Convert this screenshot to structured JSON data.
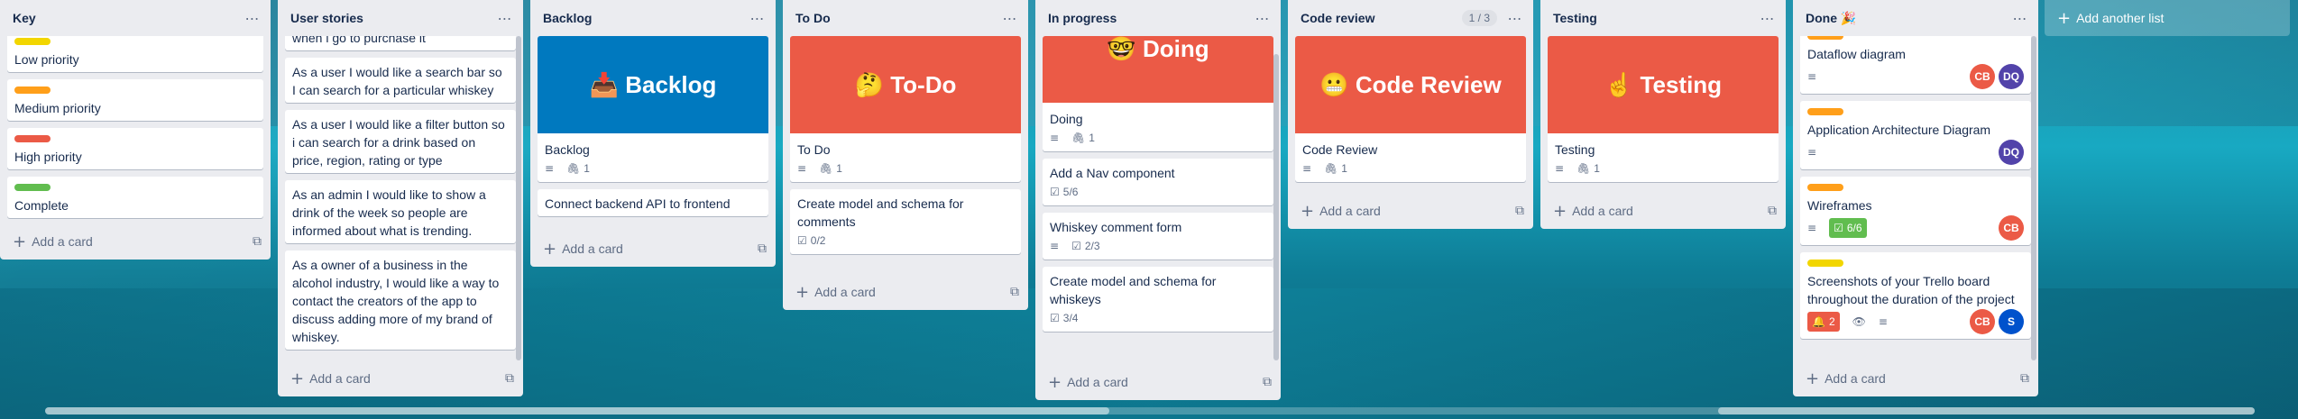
{
  "colors": {
    "yellow": "#f2d600",
    "orange": "#ff9f1a",
    "red": "#eb5a46",
    "green": "#61bd4f",
    "blue_cover": "#0079bf",
    "red_cover": "#eb5a46",
    "avatar_cb": "#eb5a46",
    "avatar_dq": "#5243aa",
    "avatar_s": "#0052cc"
  },
  "lists": {
    "key": {
      "title": "Key",
      "add_card": "Add a card",
      "cards": [
        {
          "text": "Low priority"
        },
        {
          "text": "Medium priority"
        },
        {
          "text": "High priority"
        },
        {
          "text": "Complete"
        }
      ]
    },
    "stories": {
      "title": "User stories",
      "add_card": "Add a card",
      "cards": [
        {
          "text": "when i go to purchase it"
        },
        {
          "text": "As a user I would like a search bar so I can search for a particular whiskey"
        },
        {
          "text": "As a user I would like a filter button so i can search for a drink based on price, region, rating or type"
        },
        {
          "text": "As an admin I would like to show a drink of the week so people are informed about what is trending."
        },
        {
          "text": "As a owner of a business in the alcohol industry, I would like a way to contact the creators of the app to discuss adding more of my brand of whiskey."
        }
      ]
    },
    "backlog": {
      "title": "Backlog",
      "add_card": "Add a card",
      "cards": [
        {
          "cover": "📥 Backlog",
          "text": "Backlog",
          "attachments": "1"
        },
        {
          "text": "Connect backend API to frontend"
        }
      ]
    },
    "todo": {
      "title": "To Do",
      "add_card": "Add a card",
      "cards": [
        {
          "cover": "🤔 To-Do",
          "text": "To Do",
          "attachments": "1"
        },
        {
          "text": "Create model and schema for comments",
          "checklist": "0/2"
        }
      ]
    },
    "inprogress": {
      "title": "In progress",
      "add_card": "Add a card",
      "cards": [
        {
          "cover": "🤓 Doing",
          "text": "Doing",
          "attachments": "1"
        },
        {
          "text": "Add a Nav component",
          "checklist": "5/6"
        },
        {
          "text": "Whiskey comment form",
          "checklist": "2/3"
        },
        {
          "text": "Create model and schema for whiskeys",
          "checklist": "3/4"
        }
      ]
    },
    "review": {
      "title": "Code review",
      "badge": "1 / 3",
      "add_card": "Add a card",
      "cards": [
        {
          "cover": "😬 Code Review",
          "text": "Code Review",
          "attachments": "1"
        }
      ]
    },
    "testing": {
      "title": "Testing",
      "add_card": "Add a card",
      "cards": [
        {
          "cover": "☝️ Testing",
          "text": "Testing",
          "attachments": "1"
        }
      ]
    },
    "done": {
      "title": "Done 🎉",
      "add_card": "Add a card",
      "cards": [
        {
          "text": "Dataflow diagram",
          "members": [
            "CB",
            "DQ"
          ]
        },
        {
          "text": "Application Architecture Diagram",
          "members": [
            "DQ"
          ]
        },
        {
          "text": "Wireframes",
          "checklist": "6/6",
          "members": [
            "CB"
          ]
        },
        {
          "text": "Screenshots of your Trello board throughout the duration of the project",
          "notifications": "2",
          "members": [
            "CB",
            "S"
          ]
        }
      ]
    }
  },
  "add_list": "Add another list",
  "icons": {
    "menu": "more-horizontal-icon",
    "plus": "plus-icon",
    "template": "card-template-icon",
    "description": "description-icon",
    "attachment": "paperclip-icon",
    "checklist": "checklist-icon",
    "watch": "eye-icon",
    "notification": "bell-icon"
  }
}
